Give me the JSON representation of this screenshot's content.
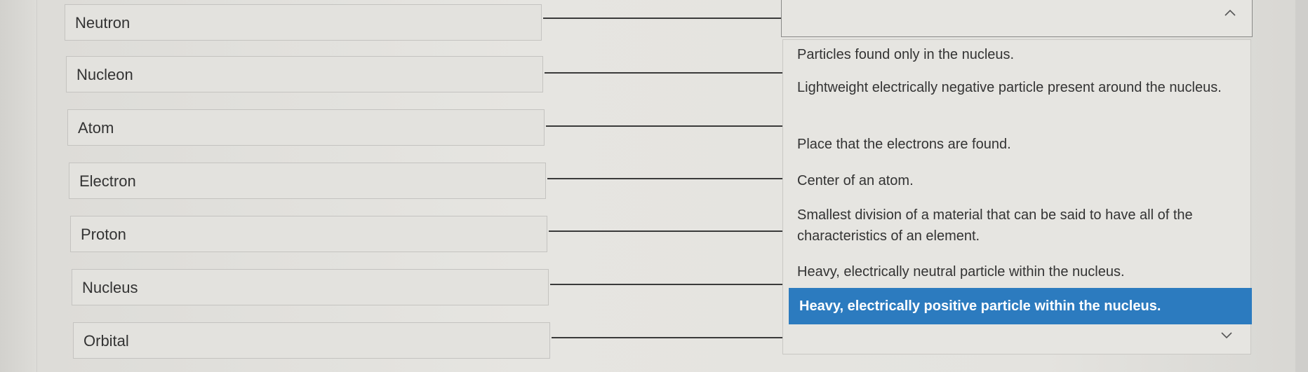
{
  "terms": [
    {
      "label": "Neutron"
    },
    {
      "label": "Nucleon"
    },
    {
      "label": "Atom"
    },
    {
      "label": "Electron"
    },
    {
      "label": "Proton"
    },
    {
      "label": "Nucleus"
    },
    {
      "label": "Orbital"
    }
  ],
  "select": {
    "current_value": "",
    "open_icon": "chevron-up-icon",
    "scroll_icon": "chevron-down-icon"
  },
  "options": [
    {
      "text": "Particles found only in the nucleus."
    },
    {
      "text": "Lightweight electrically negative particle present around the nucleus."
    },
    {
      "text": "Place that the electrons are found."
    },
    {
      "text": "Center of an atom."
    },
    {
      "text": "Smallest division of a material that can be said to have all of the characteristics of an element."
    },
    {
      "text": "Heavy, electrically neutral particle within the nucleus."
    },
    {
      "text": "Heavy, electrically positive particle within the nucleus.",
      "highlighted": true
    }
  ],
  "colors": {
    "highlight": "#2c7bbf",
    "background": "#e3e2de"
  }
}
